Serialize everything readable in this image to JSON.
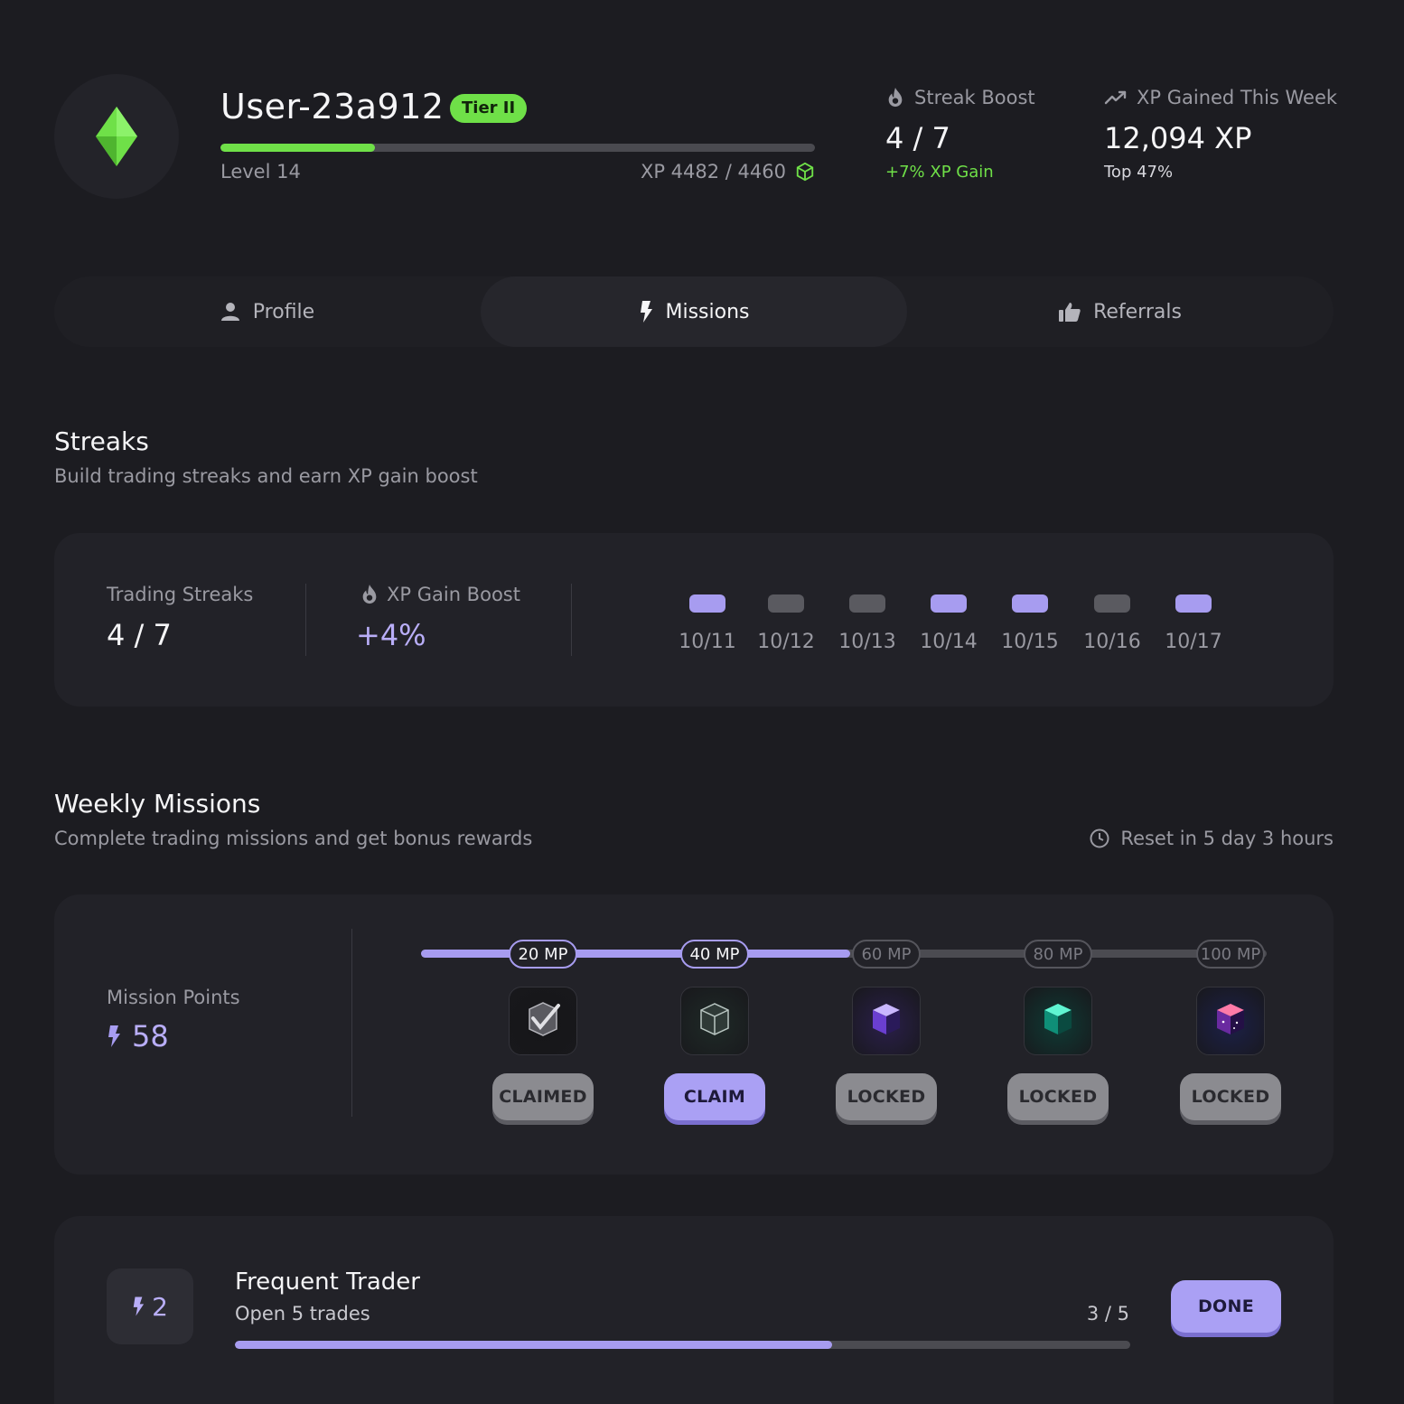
{
  "profile": {
    "username": "User-23a912",
    "tier": "Tier II",
    "level": "Level 14",
    "xp_text": "XP 4482 / 4460",
    "level_progress": 0.26
  },
  "stats": {
    "streak_boost": {
      "label": "Streak Boost",
      "value": "4 / 7",
      "sub": "+7% XP Gain"
    },
    "xp_week": {
      "label": "XP Gained This Week",
      "value": "12,094 XP",
      "sub": "Top 47%"
    }
  },
  "tabs": [
    {
      "label": "Profile",
      "icon": "user-icon"
    },
    {
      "label": "Missions",
      "icon": "lightning-icon",
      "active": true
    },
    {
      "label": "Referrals",
      "icon": "thumbs-up-icon"
    }
  ],
  "streaks": {
    "title": "Streaks",
    "subtitle": "Build trading streaks and earn XP gain boost",
    "trading_label": "Trading Streaks",
    "trading_value": "4 / 7",
    "boost_label": "XP Gain Boost",
    "boost_value": "+4%",
    "days": [
      {
        "date": "10/11",
        "active": true
      },
      {
        "date": "10/12",
        "active": false
      },
      {
        "date": "10/13",
        "active": false
      },
      {
        "date": "10/14",
        "active": true
      },
      {
        "date": "10/15",
        "active": true
      },
      {
        "date": "10/16",
        "active": false
      },
      {
        "date": "10/17",
        "active": true
      }
    ]
  },
  "weekly": {
    "title": "Weekly Missions",
    "subtitle": "Complete trading missions and get bonus rewards",
    "reset": "Reset in 5 day 3 hours",
    "points_label": "Mission Points",
    "points_value": "58",
    "progress_fraction": 0.508,
    "milestones": [
      {
        "label": "20 MP",
        "status": "CLAIMED",
        "reached": true,
        "icon": "check-cube-icon"
      },
      {
        "label": "40 MP",
        "status": "CLAIM",
        "reached": true,
        "icon": "glass-cube-icon"
      },
      {
        "label": "60 MP",
        "status": "LOCKED",
        "reached": false,
        "icon": "purple-cube-icon"
      },
      {
        "label": "80 MP",
        "status": "LOCKED",
        "reached": false,
        "icon": "teal-cube-icon"
      },
      {
        "label": "100 MP",
        "status": "LOCKED",
        "reached": false,
        "icon": "galaxy-cube-icon"
      }
    ]
  },
  "mission": {
    "points": "2",
    "title": "Frequent Trader",
    "desc": "Open 5 trades",
    "progress": "3 / 5",
    "progress_fraction": 0.667,
    "button": "DONE"
  },
  "colors": {
    "accent_green": "#6fe048",
    "accent_purple": "#a79cf0",
    "background": "#1c1c21",
    "card": "#222228"
  }
}
